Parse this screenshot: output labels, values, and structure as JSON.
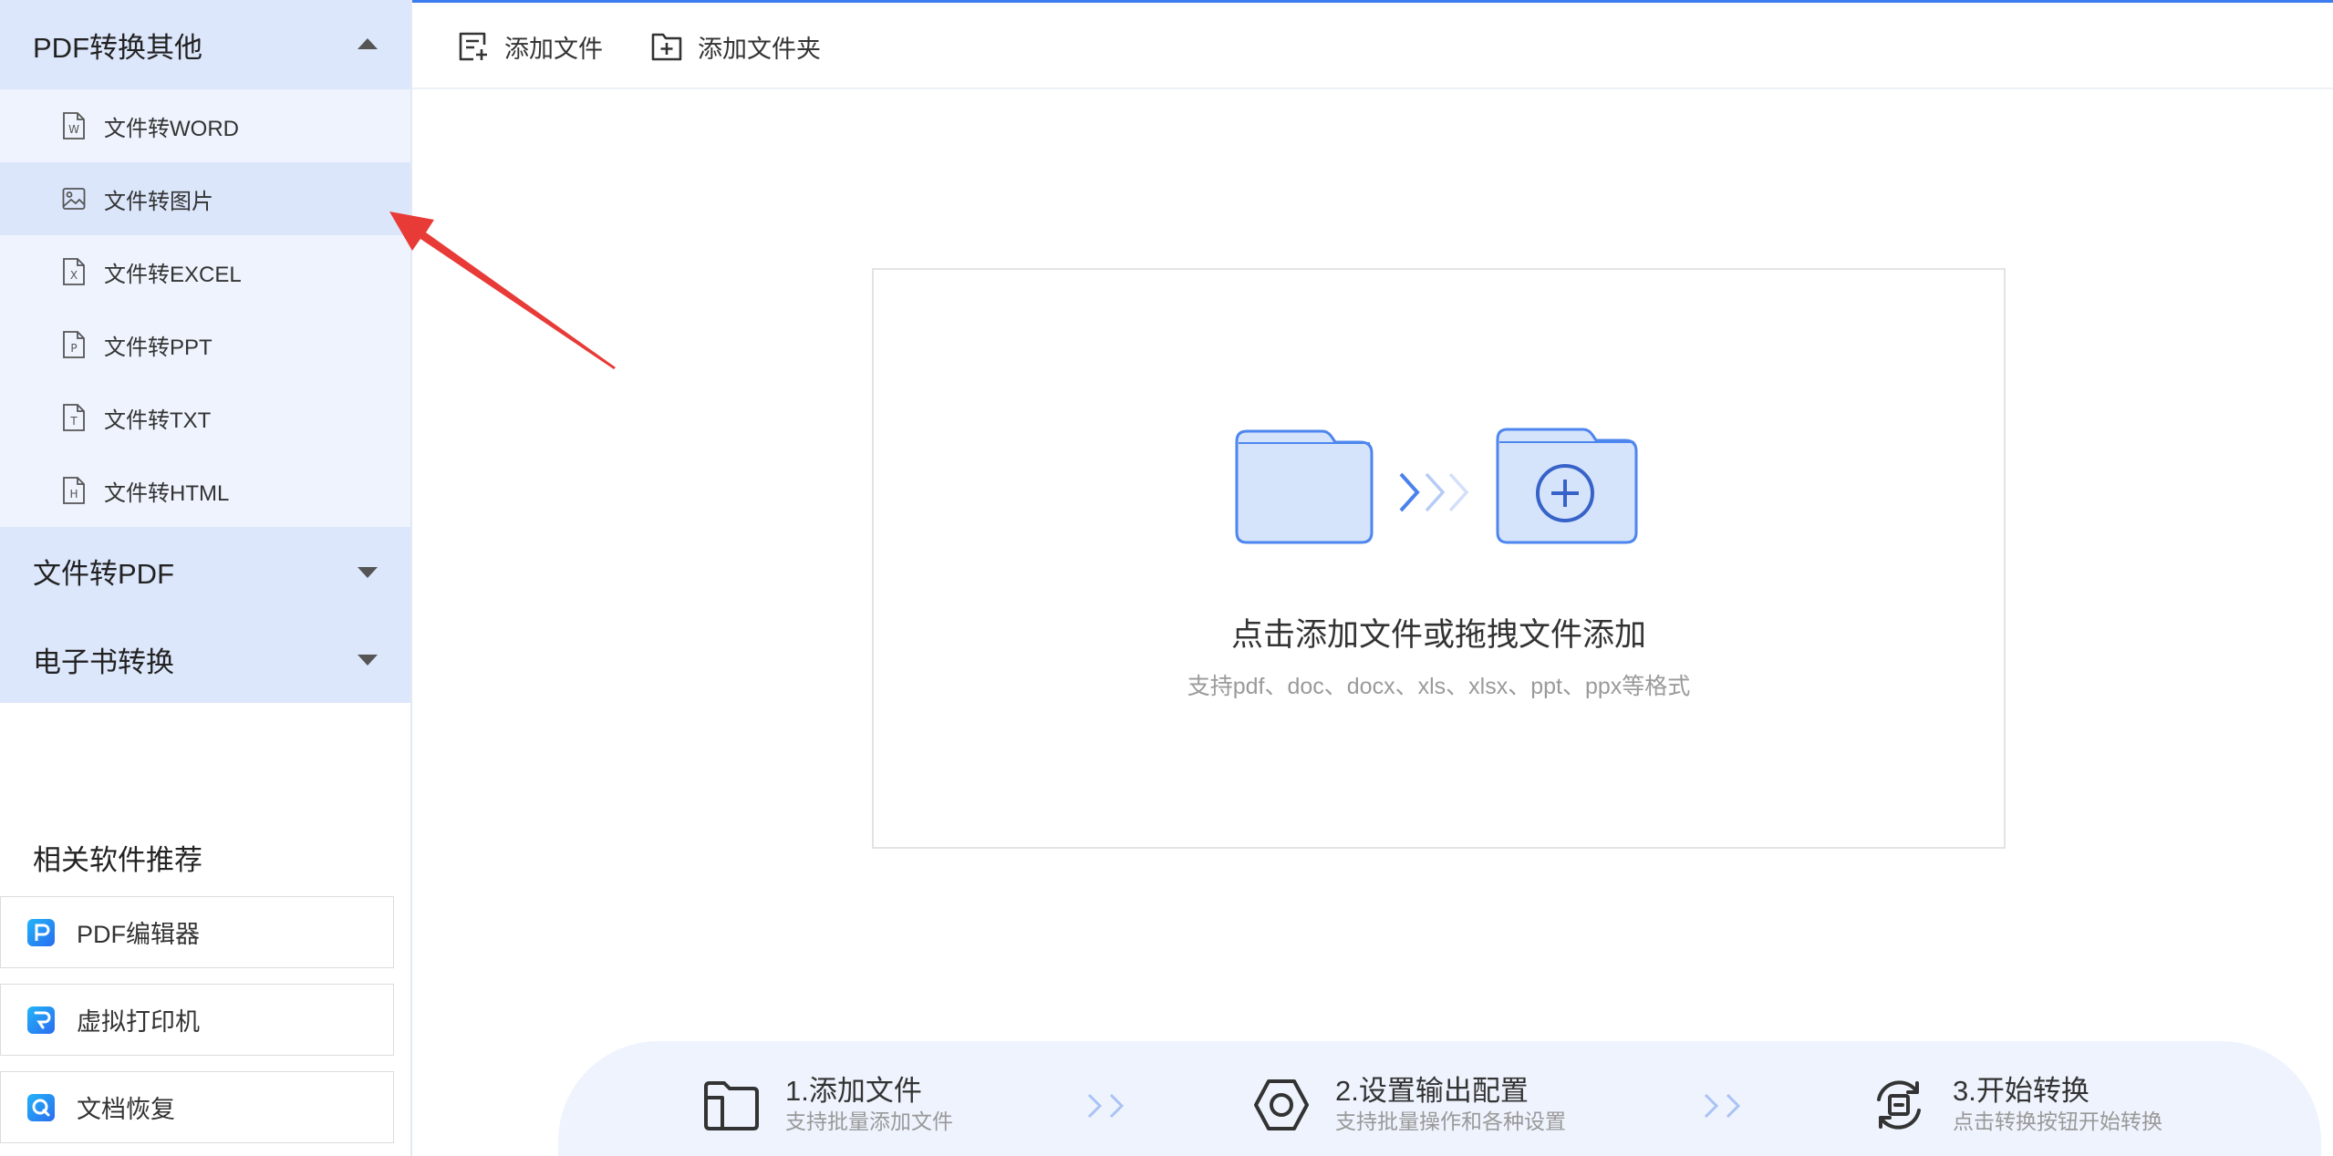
{
  "sidebar": {
    "groups": [
      {
        "label": "PDF转换其他",
        "expanded": true,
        "caret": "caret-up-icon"
      },
      {
        "label": "文件转PDF",
        "expanded": false,
        "caret": "caret-down-icon"
      },
      {
        "label": "电子书转换",
        "expanded": false,
        "caret": "caret-down-icon"
      }
    ],
    "items": [
      {
        "label": "文件转WORD",
        "icon": "word-file-icon",
        "letter": "W",
        "selected": false
      },
      {
        "label": "文件转图片",
        "icon": "image-file-icon",
        "selected": true
      },
      {
        "label": "文件转EXCEL",
        "icon": "excel-file-icon",
        "letter": "X",
        "selected": false
      },
      {
        "label": "文件转PPT",
        "icon": "ppt-file-icon",
        "letter": "P",
        "selected": false
      },
      {
        "label": "文件转TXT",
        "icon": "txt-file-icon",
        "letter": "T",
        "selected": false
      },
      {
        "label": "文件转HTML",
        "icon": "html-file-icon",
        "letter": "H",
        "selected": false
      }
    ],
    "recommend_title": "相关软件推荐",
    "recommend": [
      {
        "label": "PDF编辑器",
        "icon": "pdf-editor-app-icon"
      },
      {
        "label": "虚拟打印机",
        "icon": "virtual-printer-app-icon"
      },
      {
        "label": "文档恢复",
        "icon": "document-recovery-app-icon"
      }
    ]
  },
  "toolbar": {
    "add_file": "添加文件",
    "add_file_icon": "add-file-icon",
    "add_folder": "添加文件夹",
    "add_folder_icon": "add-folder-icon"
  },
  "dropzone": {
    "title": "点击添加文件或拖拽文件添加",
    "subtitle": "支持pdf、doc、docx、xls、xlsx、ppt、ppx等格式"
  },
  "steps": [
    {
      "title": "1.添加文件",
      "desc": "支持批量添加文件",
      "icon": "folder-icon"
    },
    {
      "title": "2.设置输出配置",
      "desc": "支持批量操作和各种设置",
      "icon": "settings-icon"
    },
    {
      "title": "3.开始转换",
      "desc": "点击转换按钮开始转换",
      "icon": "convert-icon"
    }
  ],
  "colors": {
    "accent": "#3d7bf0",
    "sidebar_group_bg": "#dde7fb",
    "sidebar_item_bg": "#eef3fd",
    "sidebar_selected_bg": "#dbe6fb",
    "annotation_arrow": "#e83a36"
  }
}
